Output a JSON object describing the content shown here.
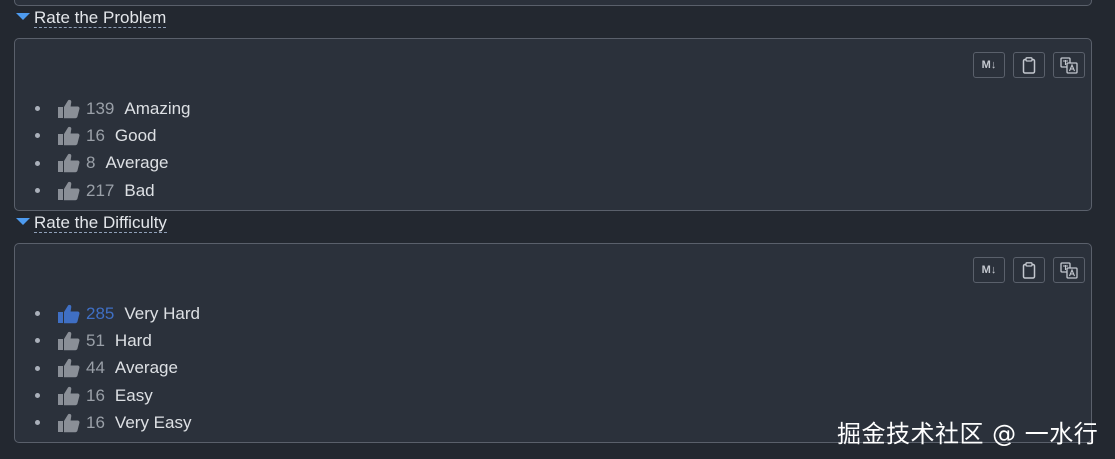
{
  "sections": [
    {
      "title": "Rate the Problem",
      "options": [
        {
          "count": "139",
          "label": "Amazing",
          "active": false
        },
        {
          "count": "16",
          "label": "Good",
          "active": false
        },
        {
          "count": "8",
          "label": "Average",
          "active": false
        },
        {
          "count": "217",
          "label": "Bad",
          "active": false
        }
      ]
    },
    {
      "title": "Rate the Difficulty",
      "options": [
        {
          "count": "285",
          "label": "Very Hard",
          "active": true
        },
        {
          "count": "51",
          "label": "Hard",
          "active": false
        },
        {
          "count": "44",
          "label": "Average",
          "active": false
        },
        {
          "count": "16",
          "label": "Easy",
          "active": false
        },
        {
          "count": "16",
          "label": "Very Easy",
          "active": false
        }
      ]
    }
  ],
  "toolbar": {
    "markdown_label": "M↓",
    "icons": [
      "markdown-icon",
      "clipboard-icon",
      "translate-icon"
    ]
  },
  "colors": {
    "accent": "#4d9bf0",
    "active_thumb": "#3f6fc4",
    "inactive_thumb": "#8a8f97"
  },
  "watermark": "掘金技术社区 @ 一水行"
}
